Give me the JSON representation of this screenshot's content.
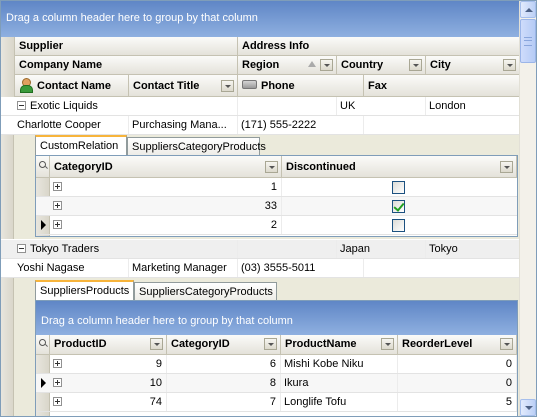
{
  "group_panel_text": "Drag a column header here to group by that column",
  "bands": {
    "supplier": "Supplier",
    "address_info": "Address Info"
  },
  "columns": {
    "company_name": "Company Name",
    "region": "Region",
    "country": "Country",
    "city": "City",
    "contact_name": "Contact Name",
    "contact_title": "Contact Title",
    "phone": "Phone",
    "fax": "Fax"
  },
  "suppliers": [
    {
      "company": "Exotic Liquids",
      "country": "UK",
      "city": "London",
      "contact_name": "Charlotte Cooper",
      "contact_title": "Purchasing  Mana...",
      "phone": "(171) 555-2222",
      "fax": ""
    },
    {
      "company": "Tokyo Traders",
      "country": "Japan",
      "city": "Tokyo",
      "contact_name": "Yoshi Nagase",
      "contact_title": "Marketing Manager",
      "phone": "(03) 3555-5011",
      "fax": ""
    }
  ],
  "detail1": {
    "tabs": [
      "CustomRelation",
      "SuppliersCategoryProducts"
    ],
    "active_tab": 0,
    "columns": {
      "category_id": "CategoryID",
      "discontinued": "Discontinued"
    },
    "rows": [
      {
        "category_id": "1",
        "discontinued": false
      },
      {
        "category_id": "33",
        "discontinued": true
      },
      {
        "category_id": "2",
        "discontinued": false
      }
    ]
  },
  "detail2": {
    "tabs": [
      "SuppliersProducts",
      "SuppliersCategoryProducts"
    ],
    "active_tab": 0,
    "group_panel_text": "Drag a column header here to group by that column",
    "columns": {
      "product_id": "ProductID",
      "category_id": "CategoryID",
      "product_name": "ProductName",
      "reorder_level": "ReorderLevel"
    },
    "rows": [
      {
        "product_id": "9",
        "category_id": "6",
        "product_name": "Mishi Kobe Niku",
        "reorder_level": "0"
      },
      {
        "product_id": "10",
        "category_id": "8",
        "product_name": "Ikura",
        "reorder_level": "0"
      },
      {
        "product_id": "74",
        "category_id": "7",
        "product_name": "Longlife Tofu",
        "reorder_level": "5"
      }
    ]
  },
  "colors": {
    "group_panel": "#6f94d0",
    "active_tab_accent": "#f7b43b",
    "border": "#7f9db9"
  }
}
